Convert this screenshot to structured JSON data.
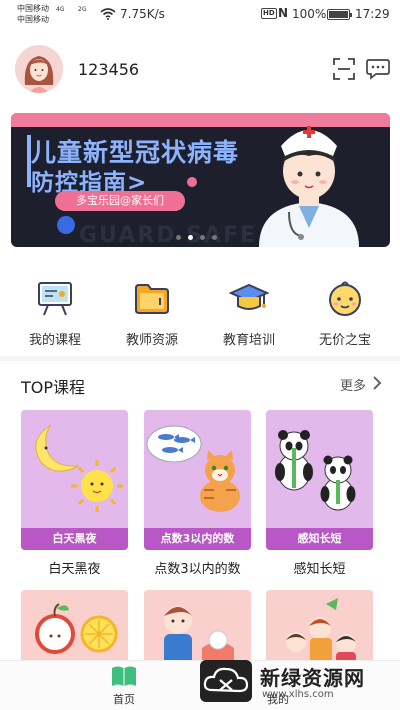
{
  "status_bar": {
    "carrier1": "中国移动",
    "carrier2": "中国移动",
    "net1": "4G",
    "net2": "2G",
    "speed": "7.75K/s",
    "hd": "HD",
    "nfc": "N",
    "battery": "100%",
    "battery_level": 1.0,
    "time": "17:29"
  },
  "header": {
    "username": "123456",
    "avatar_icon": "girl-avatar-icon",
    "scan_icon": "scan-icon",
    "message_icon": "message-icon"
  },
  "banner": {
    "title_line1": "儿童新型冠状病毒",
    "title_line2": "防控指南>",
    "pill": "多宝乐园@家长们",
    "watermark": "GUARD SAFE",
    "dots_total": 4,
    "dots_active": 1
  },
  "menu": [
    {
      "label": "我的课程",
      "icon": "teaching-board-icon"
    },
    {
      "label": "教师资源",
      "icon": "folder-icon"
    },
    {
      "label": "教育培训",
      "icon": "graduation-cap-icon"
    },
    {
      "label": "无价之宝",
      "icon": "baby-face-icon"
    }
  ],
  "top_section": {
    "title": "TOP课程",
    "more": "更多"
  },
  "courses": [
    {
      "tag": "白天黑夜",
      "caption": "白天黑夜"
    },
    {
      "tag": "点数3以内的数",
      "caption": "点数3以内的数"
    },
    {
      "tag": "感知长短",
      "caption": "感知长短"
    }
  ],
  "bottom_nav": {
    "home": "首页",
    "mine": "我的"
  },
  "watermark": {
    "title": "新绿资源网",
    "url": "www.xlhs.com"
  },
  "colors": {
    "accent_green": "#3fbf7f",
    "card_bg": "#e3b8ea",
    "card_tag": "#b957c7",
    "banner_bg": "#1d1f2c",
    "banner_text": "#8db3ff",
    "banner_pink": "#ef6f95"
  }
}
